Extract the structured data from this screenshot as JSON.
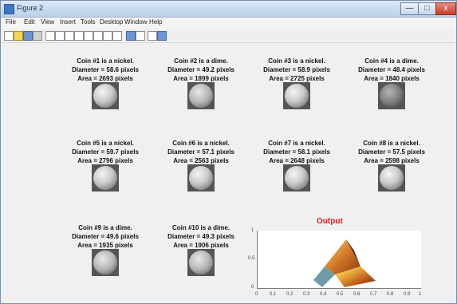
{
  "window": {
    "title": "Figure 2",
    "buttons": {
      "minimize": "—",
      "maximize": "□",
      "close": "x"
    }
  },
  "menu": [
    "File",
    "Edit",
    "View",
    "Insert",
    "Tools",
    "Desktop",
    "Window",
    "Help"
  ],
  "toolbar": [
    "new-icon",
    "open-icon",
    "save-icon",
    "print-icon",
    "pointer-icon",
    "zoom-in-icon",
    "zoom-out-icon",
    "pan-icon",
    "rotate-icon",
    "data-cursor-icon",
    "brush-icon",
    "link-icon",
    "colorbar-icon",
    "legend-icon",
    "hide-plot-icon",
    "show-plot-icon"
  ],
  "coins": [
    {
      "line1": "Coin #1 is a nickel.",
      "line2": "Diameter = 58.6 pixels",
      "line3": "Area = 2693 pixels"
    },
    {
      "line1": "Coin #2 is a dime.",
      "line2": "Diameter = 49.2 pixels",
      "line3": "Area = 1899 pixels"
    },
    {
      "line1": "Coin #3 is a nickel.",
      "line2": "Diameter = 58.9 pixels",
      "line3": "Area = 2725 pixels"
    },
    {
      "line1": "Coin #4 is a dime.",
      "line2": "Diameter = 48.4 pixels",
      "line3": "Area = 1840 pixels"
    },
    {
      "line1": "Coin #5 is a nickel.",
      "line2": "Diameter = 59.7 pixels",
      "line3": "Area = 2796 pixels"
    },
    {
      "line1": "Coin #6 is a nickel.",
      "line2": "Diameter = 57.1 pixels",
      "line3": "Area = 2563 pixels"
    },
    {
      "line1": "Coin #7 is a nickel.",
      "line2": "Diameter = 58.1 pixels",
      "line3": "Area = 2648 pixels"
    },
    {
      "line1": "Coin #8 is a nickel.",
      "line2": "Diameter = 57.5 pixels",
      "line3": "Area = 2598 pixels"
    },
    {
      "line1": "Coin #9 is a dime.",
      "line2": "Diameter = 49.6 pixels",
      "line3": "Area = 1935 pixels"
    },
    {
      "line1": "Coin #10 is a dime.",
      "line2": "Diameter = 49.3 pixels",
      "line3": "Area = 1906 pixels"
    }
  ],
  "output": {
    "title": "Output",
    "y_ticks": [
      "1",
      "0.5",
      "0"
    ],
    "x_ticks": [
      "0",
      "0.1",
      "0.2",
      "0.3",
      "0.4",
      "0.5",
      "0.6",
      "0.7",
      "0.8",
      "0.9",
      "1"
    ]
  }
}
